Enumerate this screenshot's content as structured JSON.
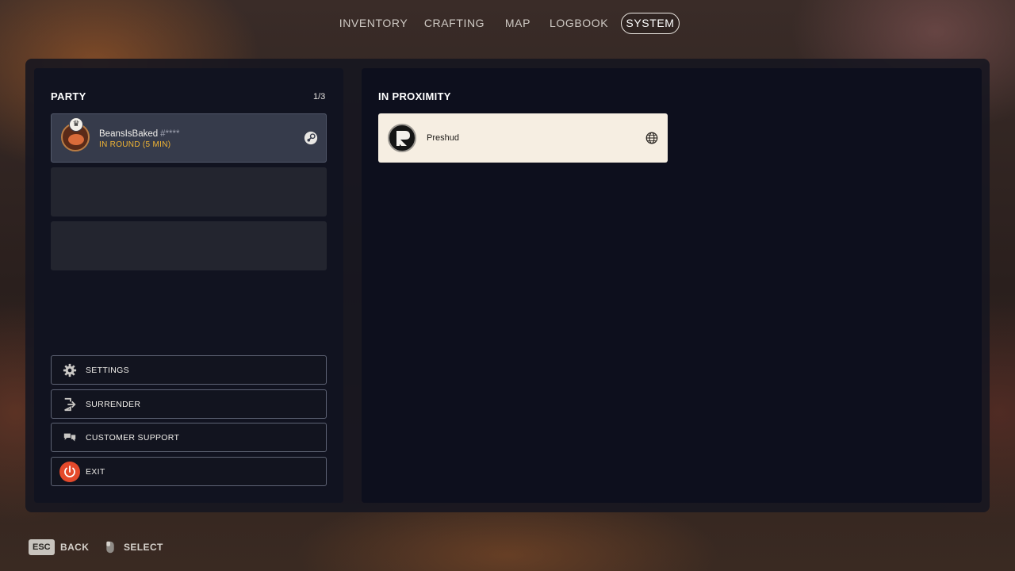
{
  "nav": {
    "tabs": [
      {
        "label": "INVENTORY"
      },
      {
        "label": "CRAFTING"
      },
      {
        "label": "MAP"
      },
      {
        "label": "LOGBOOK"
      },
      {
        "label": "SYSTEM",
        "active": true
      }
    ]
  },
  "party": {
    "title": "PARTY",
    "count": "1/3",
    "members": [
      {
        "name": "BeansIsBaked",
        "tag": "#****",
        "status": "IN ROUND (5 MIN)",
        "platform_icon": "steam-icon",
        "leader": true
      }
    ],
    "empty_slots": 2
  },
  "menu": {
    "settings_label": "SETTINGS",
    "surrender_label": "SURRENDER",
    "support_label": "CUSTOMER SUPPORT",
    "exit_label": "EXIT"
  },
  "proximity": {
    "title": "IN PROXIMITY",
    "players": [
      {
        "name": "Preshud",
        "platform_icon": "globe-icon"
      }
    ]
  },
  "footer": {
    "back_key": "ESC",
    "back_label": "BACK",
    "select_label": "SELECT"
  },
  "colors": {
    "status_accent": "#f2b534",
    "exit_accent": "#e4492b",
    "proximity_card": "#f6eee2"
  }
}
